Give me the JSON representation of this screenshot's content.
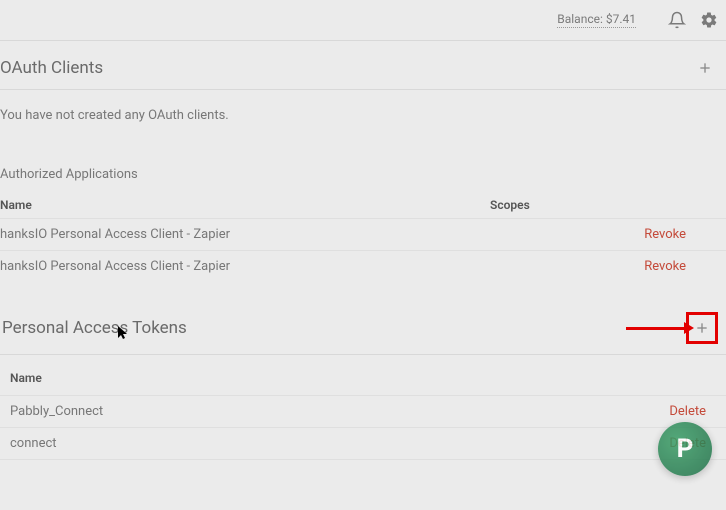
{
  "header": {
    "balance_label": "Balance: $7.41"
  },
  "oauth": {
    "title": "OAuth Clients",
    "empty": "You have not created any OAuth clients."
  },
  "auth_apps": {
    "title": "Authorized Applications",
    "col_name": "Name",
    "col_scopes": "Scopes",
    "rows": [
      {
        "name": "hanksIO Personal Access Client - Zapier",
        "action": "Revoke"
      },
      {
        "name": "hanksIO Personal Access Client - Zapier",
        "action": "Revoke"
      }
    ]
  },
  "pat": {
    "title": "Personal Access Tokens",
    "col_name": "Name",
    "rows": [
      {
        "name": "Pabbly_Connect",
        "action": "Delete"
      },
      {
        "name": "connect",
        "action": "Delete"
      }
    ]
  },
  "fab_letter": "P"
}
